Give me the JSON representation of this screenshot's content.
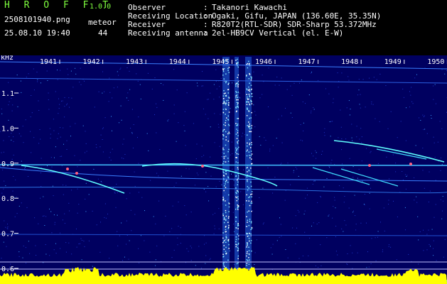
{
  "header": {
    "app_title": "H R O F F T",
    "app_version": "1.0.0",
    "file_name": "2508101940.png",
    "timestamp": "25.08.10 19:40",
    "meteor_label": "meteor",
    "meteor_count": "44"
  },
  "info": [
    {
      "label": "Observer",
      "value": "Takanori Kawachi"
    },
    {
      "label": "Receiving Location",
      "value": "Ogaki, Gifu, JAPAN (136.60E, 35.35N)"
    },
    {
      "label": "Receiver",
      "value": "R820T2(RTL-SDR) SDR-Sharp 53.372MHz"
    },
    {
      "label": "Receiving antenna",
      "value": "2el-HB9CV Vertical (el. E-W)"
    }
  ],
  "spectrogram": {
    "freq_unit": "kHz",
    "time_labels": [
      "1941",
      "1942",
      "1943",
      "1944",
      "1945",
      "1946",
      "1947",
      "1948",
      "1949",
      "1950"
    ],
    "freq_labels": [
      "1.1",
      "1.0",
      "0.9",
      "0.8",
      "0.7",
      "0.6"
    ],
    "colors": {
      "background": "#000060",
      "header_green": "#7fff3f",
      "bottom_bar": "#ffff00",
      "bottom_base": "#00ffff"
    }
  }
}
